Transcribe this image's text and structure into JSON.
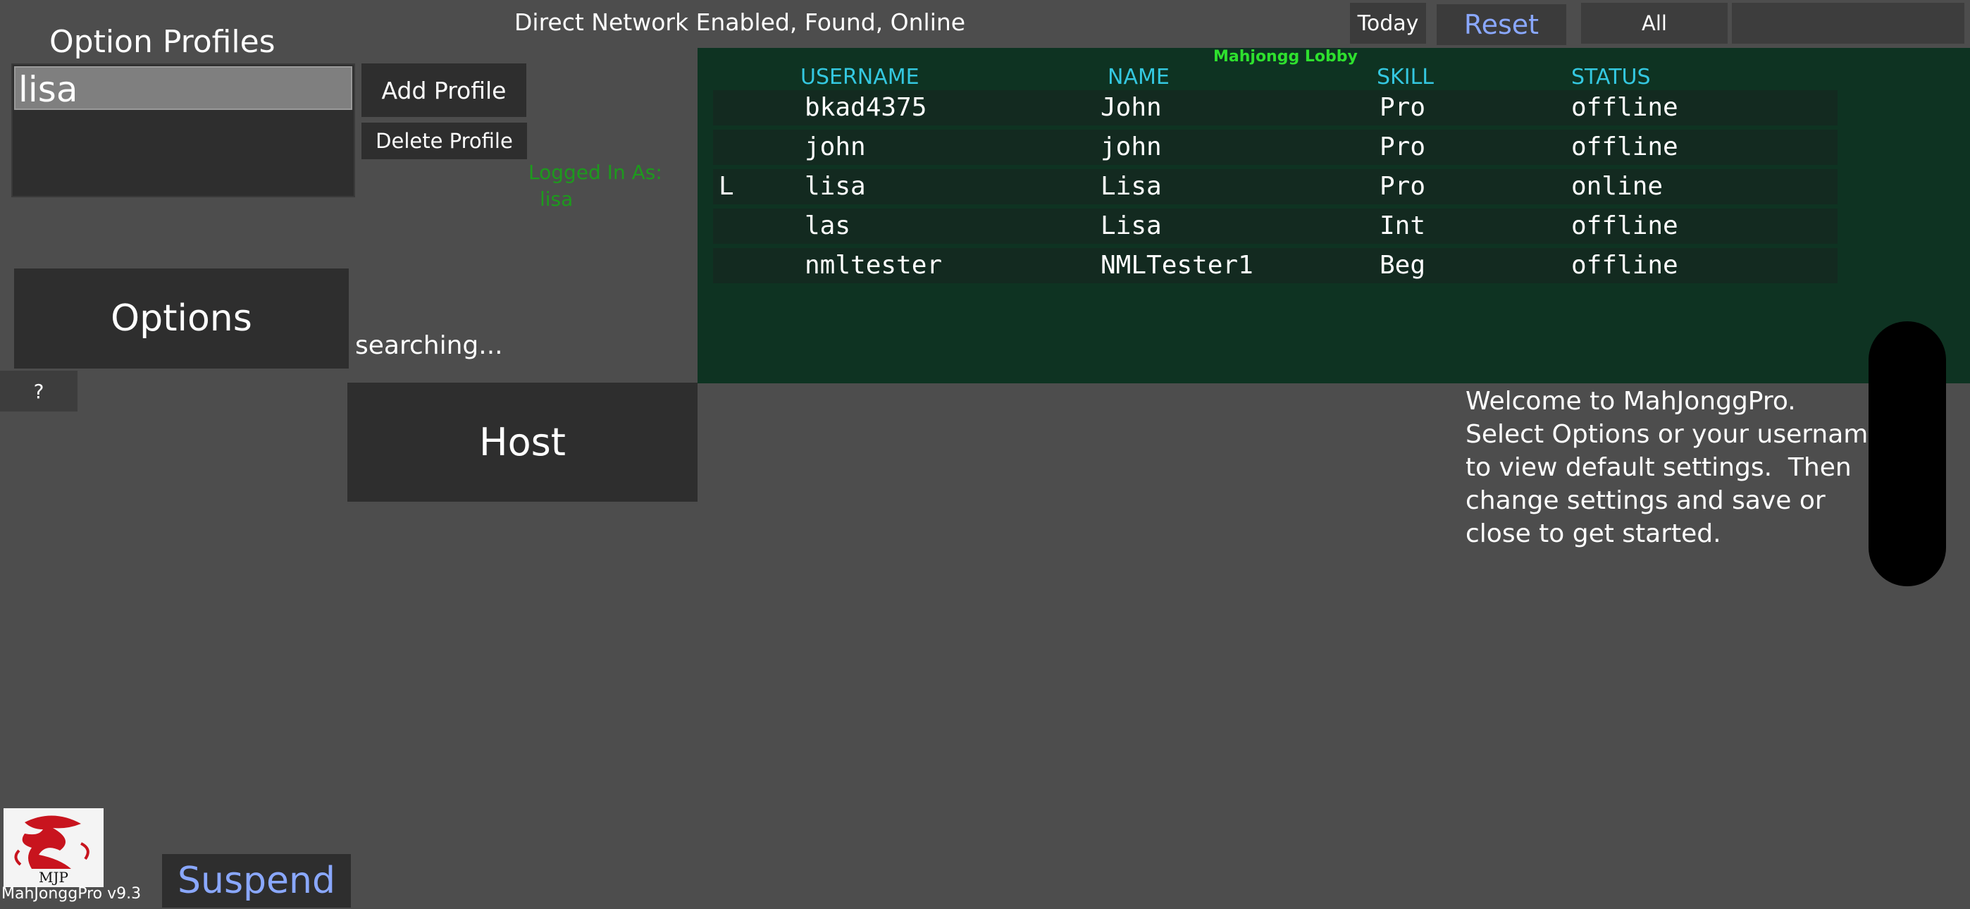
{
  "profiles": {
    "title": "Option Profiles",
    "selected": "lisa",
    "add_label": "Add Profile",
    "delete_label": "Delete Profile"
  },
  "session": {
    "logged_in_label": "Logged In As:",
    "logged_in_user": "lisa",
    "searching": "searching..."
  },
  "buttons": {
    "options": "Options",
    "help": "?",
    "host": "Host",
    "today": "Today",
    "reset": "Reset",
    "filter_all": "All",
    "suspend": "Suspend"
  },
  "header": {
    "network_status": "Direct Network Enabled, Found, Online"
  },
  "lobby": {
    "title": "Mahjongg Lobby",
    "columns": [
      "USERNAME",
      "NAME",
      "SKILL",
      "STATUS"
    ],
    "rows": [
      {
        "flag": "",
        "username": "bkad4375",
        "name": "John",
        "skill": "Pro",
        "status": "offline"
      },
      {
        "flag": "",
        "username": "john",
        "name": "john",
        "skill": "Pro",
        "status": "offline"
      },
      {
        "flag": "L",
        "username": "lisa",
        "name": "Lisa",
        "skill": "Pro",
        "status": "online"
      },
      {
        "flag": "",
        "username": "las",
        "name": "Lisa",
        "skill": "Int",
        "status": "offline"
      },
      {
        "flag": "",
        "username": "nmltester",
        "name": "NMLTester1",
        "skill": "Beg",
        "status": "offline"
      }
    ]
  },
  "welcome": {
    "text": "Welcome to MahJonggPro.\nSelect Options or your username\nto view default settings.  Then\nchange settings and save or\nclose to get started."
  },
  "footer": {
    "logo_text": "MJP",
    "version": "MahJonggPro v9.3"
  },
  "colors": {
    "background": "#4d4d4d",
    "lobby_bg": "#0e3322",
    "header_cyan": "#34c8e0",
    "accent_blue": "#8aa8ff",
    "logged_in_green": "#1d9a1d"
  }
}
